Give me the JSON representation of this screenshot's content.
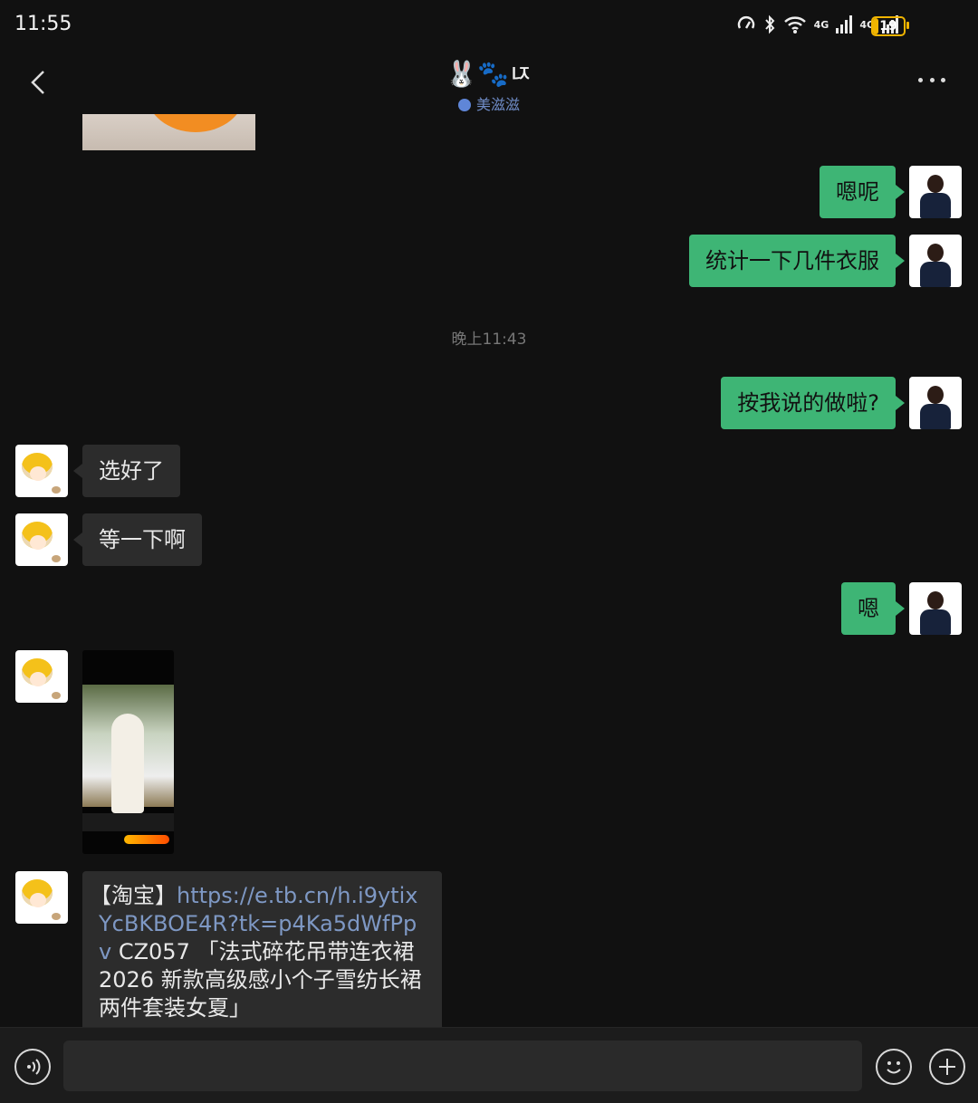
{
  "status_bar": {
    "time": "11:55",
    "network_1": "4G",
    "network_2": "4G",
    "battery_level": "19"
  },
  "header": {
    "title": "🐰🐾ㄵ",
    "subtitle": "美滋滋",
    "back_icon": "chevron-left-icon",
    "more_icon": "more-dots-icon"
  },
  "messages": {
    "m1": "嗯呢",
    "m2": "统计一下几件衣服",
    "timestamp": "晚上11:43",
    "m3": "按我说的做啦?",
    "m4": "选好了",
    "m5": "等一下啊",
    "m6": "嗯",
    "link_prefix": "【淘宝】",
    "link_url": "https://e.tb.cn/h.i9ytixYcBKBOE4R?tk=p4Ka5dWfPpv",
    "link_text": " CZ057 「法式碎花吊带连衣裙 2026 新款高级感小个子雪纺长裙两件套装女夏」"
  },
  "input_bar": {
    "voice_icon": "voice-icon",
    "emoji_icon": "emoji-icon",
    "plus_icon": "plus-icon"
  },
  "colors": {
    "bubble_me": "#3eb575",
    "bubble_other": "#2c2c2c",
    "background": "#111111",
    "link": "#7e98c4"
  }
}
